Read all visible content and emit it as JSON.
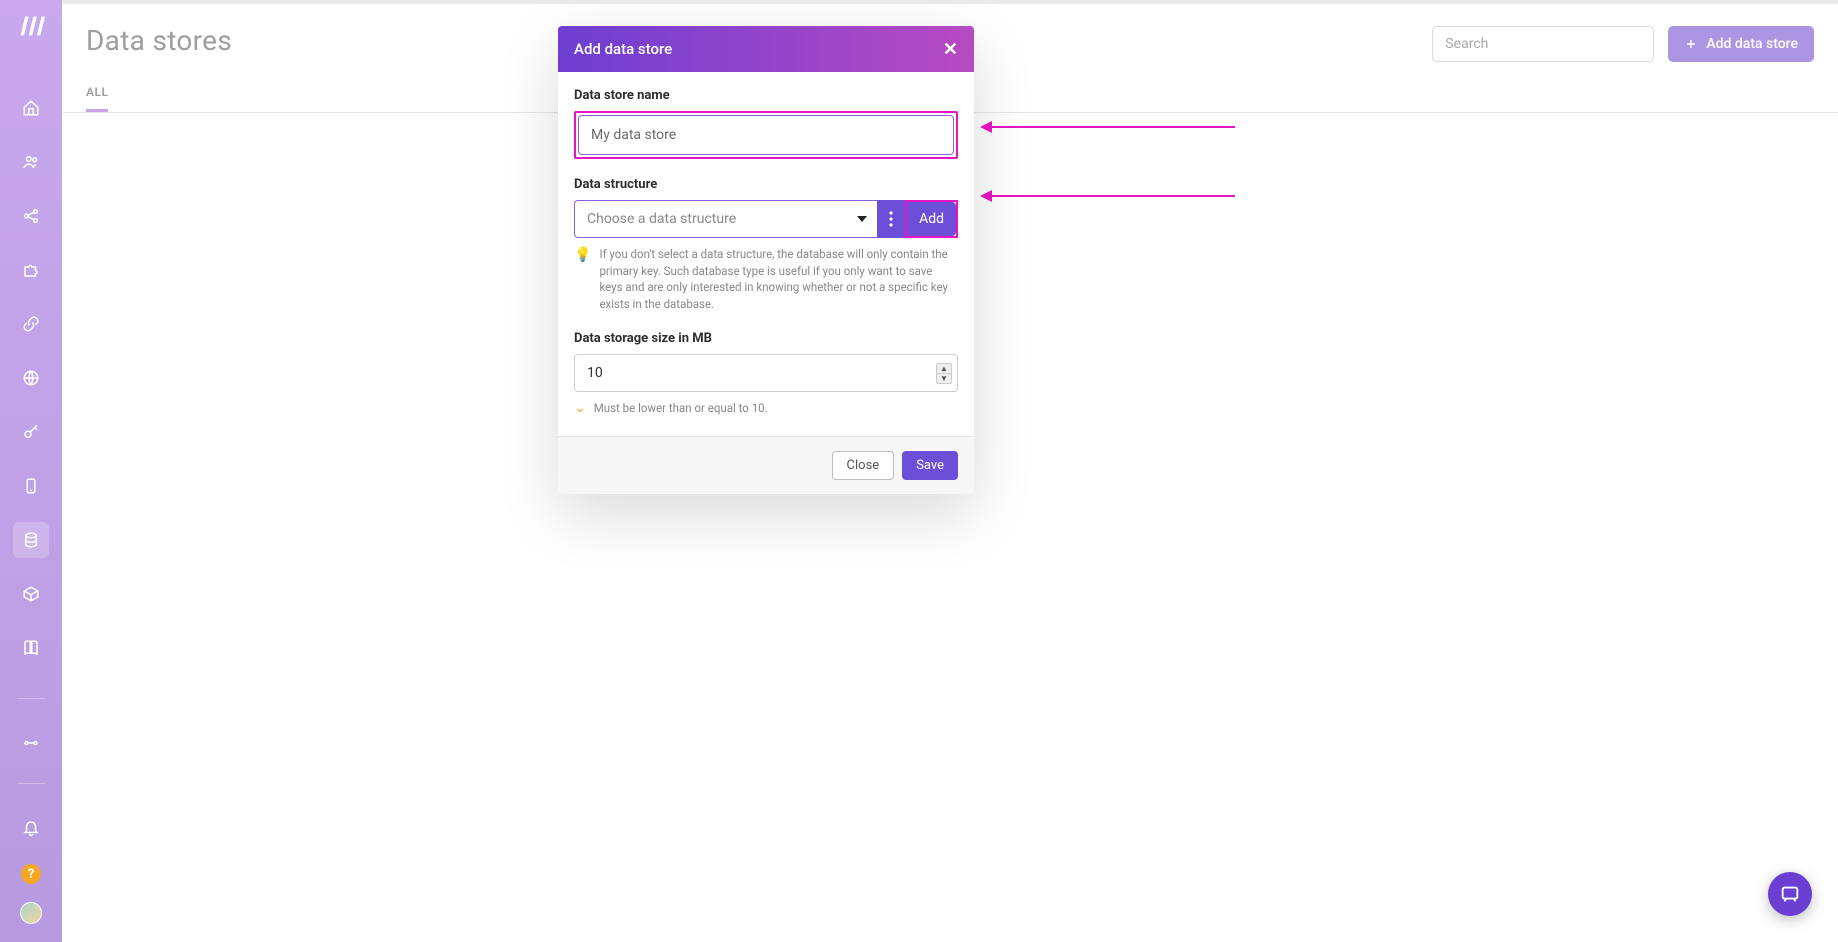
{
  "page": {
    "title": "Data stores",
    "tabs": [
      "ALL"
    ],
    "search_placeholder": "Search",
    "add_button": "Add data store"
  },
  "modal": {
    "title": "Add data store",
    "fields": {
      "name_label": "Data store name",
      "name_value": "My data store",
      "structure_label": "Data structure",
      "structure_placeholder": "Choose a data structure",
      "add_label": "Add",
      "structure_hint": "If you don't select a data structure, the database will only contain the primary key. Such database type is useful if you only want to save keys and are only interested in knowing whether or not a specific key exists in the database.",
      "size_label": "Data storage size in MB",
      "size_value": "10",
      "size_warn": "Must be lower than or equal to 10."
    },
    "footer": {
      "close": "Close",
      "save": "Save"
    }
  },
  "sidebar": {
    "items": [
      "home",
      "users",
      "share",
      "puzzle",
      "link",
      "globe",
      "key",
      "mobile",
      "database",
      "cube",
      "book"
    ],
    "active": "database",
    "bottom": [
      "branch",
      "bell",
      "help",
      "avatar"
    ]
  }
}
